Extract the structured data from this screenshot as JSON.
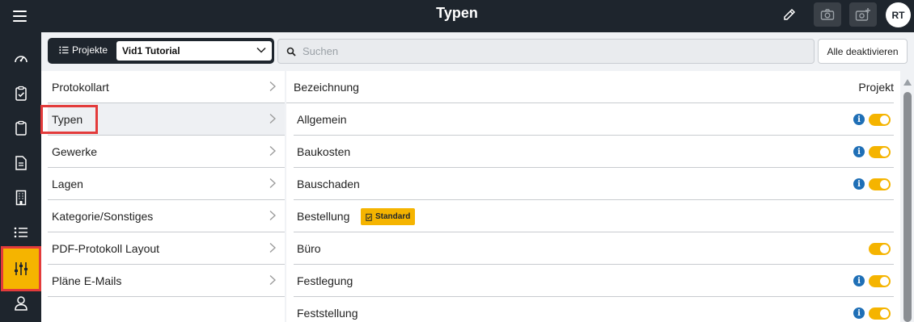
{
  "header": {
    "title": "Typen",
    "avatar_initials": "RT",
    "icons": [
      "menu-icon",
      "edit-icon",
      "camera-icon",
      "add-photo-icon"
    ]
  },
  "sidebar": {
    "items": [
      {
        "icon": "dashboard-icon"
      },
      {
        "icon": "clipboard-check-icon"
      },
      {
        "icon": "clipboard-icon"
      },
      {
        "icon": "document-icon"
      },
      {
        "icon": "building-icon"
      },
      {
        "icon": "list-icon"
      },
      {
        "icon": "sliders-icon",
        "active": true
      },
      {
        "icon": "user-icon"
      }
    ]
  },
  "toolbar": {
    "projects_label": "Projekte",
    "project_value": "Vid1 Tutorial",
    "search_placeholder": "Suchen",
    "deactivate_label": "Alle deaktivieren"
  },
  "categories": [
    {
      "label": "Protokollart"
    },
    {
      "label": "Typen",
      "selected": true
    },
    {
      "label": "Gewerke"
    },
    {
      "label": "Lagen"
    },
    {
      "label": "Kategorie/Sonstiges"
    },
    {
      "label": "PDF-Protokoll Layout"
    },
    {
      "label": "Pläne E-Mails"
    }
  ],
  "table": {
    "col_name": "Bezeichnung",
    "col_project": "Projekt",
    "rows": [
      {
        "name": "Allgemein",
        "info": true,
        "toggle": true
      },
      {
        "name": "Baukosten",
        "info": true,
        "toggle": true
      },
      {
        "name": "Bauschaden",
        "info": true,
        "toggle": true
      },
      {
        "name": "Bestellung",
        "badge": "Standard",
        "toggle": false
      },
      {
        "name": "Büro",
        "info": false,
        "toggle": true
      },
      {
        "name": "Festlegung",
        "info": true,
        "toggle": true
      },
      {
        "name": "Feststellung",
        "info": true,
        "toggle": true
      }
    ]
  },
  "colors": {
    "accent": "#f5b400",
    "dark": "#1e252d",
    "highlight": "#e33b3b",
    "info": "#1f6fb6"
  }
}
